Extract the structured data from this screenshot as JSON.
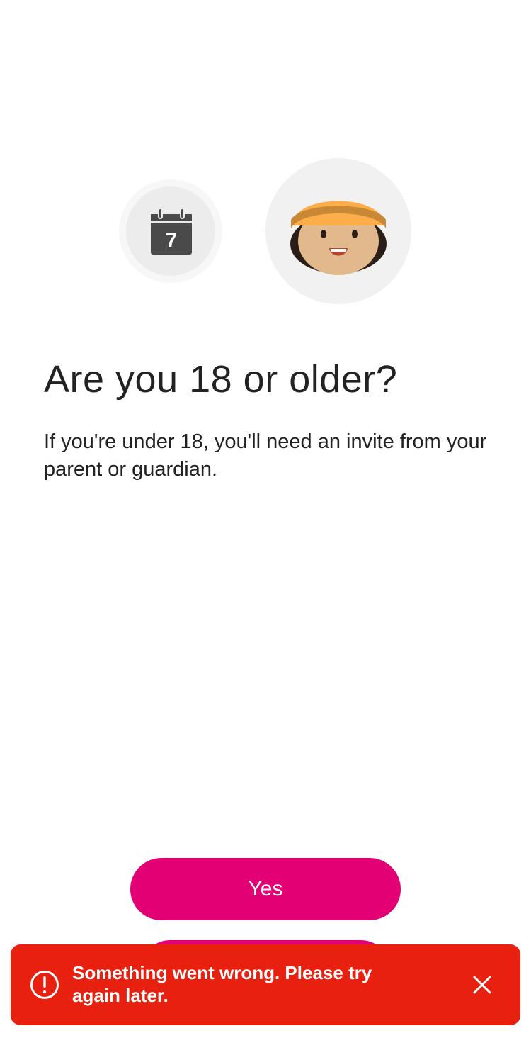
{
  "header": {
    "calendar_day": "7",
    "title": "Are you 18 or older?",
    "description": "If you're under 18, you'll need an invite from your parent or guardian."
  },
  "actions": {
    "yes_label": "Yes",
    "no_label": ""
  },
  "toast": {
    "message": "Something went wrong. Please try again later.",
    "icon": "alert-circle-icon",
    "close_icon": "close-icon"
  },
  "colors": {
    "brand": "#e20074",
    "error": "#e8200f"
  }
}
